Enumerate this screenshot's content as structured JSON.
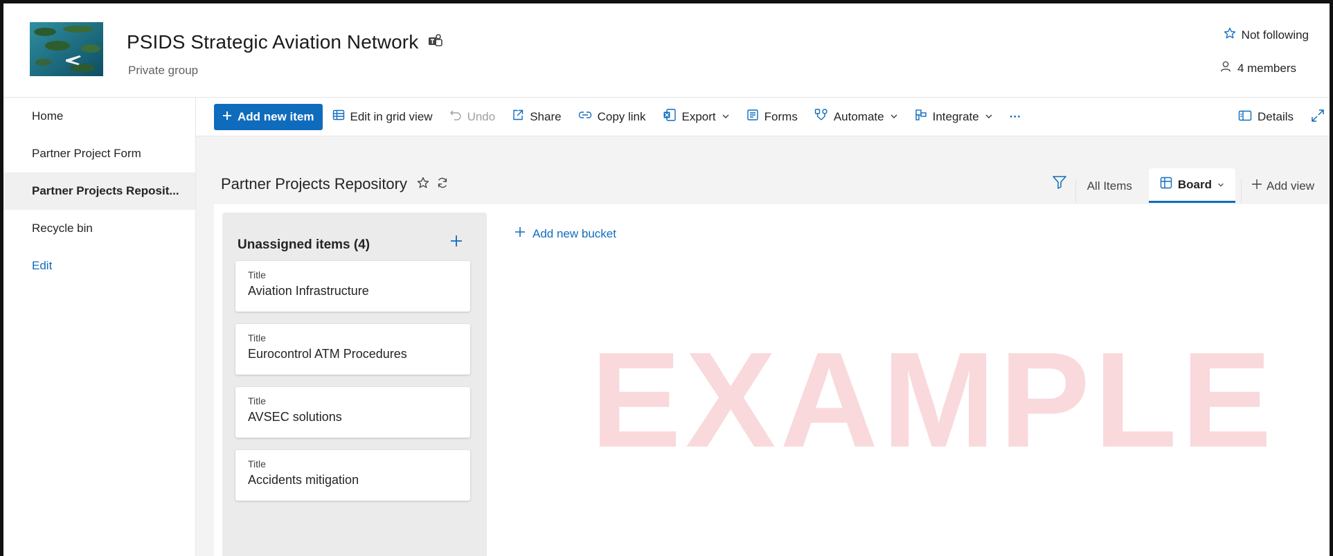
{
  "site": {
    "title": "PSIDS Strategic Aviation Network",
    "subtitle": "Private group",
    "follow_label": "Not following",
    "members_label": "4 members"
  },
  "nav": {
    "items": [
      {
        "label": "Home"
      },
      {
        "label": "Partner Project Form"
      },
      {
        "label": "Partner Projects Reposit..."
      },
      {
        "label": "Recycle bin"
      },
      {
        "label": "Edit"
      }
    ]
  },
  "toolbar": {
    "add_new_item": "Add new item",
    "edit_grid": "Edit in grid view",
    "undo": "Undo",
    "share": "Share",
    "copy_link": "Copy link",
    "export": "Export",
    "forms": "Forms",
    "automate": "Automate",
    "integrate": "Integrate",
    "more": "···",
    "details": "Details"
  },
  "list": {
    "title": "Partner Projects Repository",
    "views": {
      "all_items": "All Items",
      "board": "Board",
      "add_view": "Add view"
    }
  },
  "board": {
    "bucket_title": "Unassigned items (4)",
    "add_bucket": "Add new bucket",
    "cards": [
      {
        "label": "Title",
        "title": "Aviation Infrastructure"
      },
      {
        "label": "Title",
        "title": "Eurocontrol ATM Procedures"
      },
      {
        "label": "Title",
        "title": "AVSEC solutions"
      },
      {
        "label": "Title",
        "title": "Accidents mitigation"
      }
    ]
  },
  "watermark": "EXAMPLE",
  "colors": {
    "accent": "#0f6cbd",
    "watermark": "#f2a6ad",
    "selected_nav_bg": "#f0f0f0"
  }
}
